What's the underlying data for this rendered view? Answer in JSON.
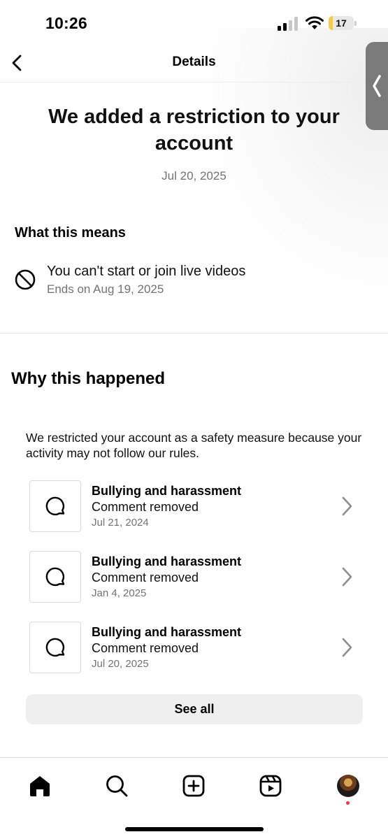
{
  "status_bar": {
    "time": "10:26",
    "battery_level": "17",
    "battery_fraction": 0.17,
    "icons": [
      "cellular-signal-icon",
      "wifi-icon",
      "battery-icon"
    ]
  },
  "nav": {
    "title": "Details",
    "back_icon": "chevron-left-icon"
  },
  "header": {
    "title": "We added a restriction to your account",
    "date": "Jul 20, 2025"
  },
  "meaning": {
    "heading": "What this means",
    "restriction_icon": "prohibited-icon",
    "restriction_title": "You can't start or join live videos",
    "restriction_ends": "Ends on Aug 19, 2025"
  },
  "why": {
    "heading": "Why this happened",
    "body": "We restricted your account as a safety measure because your activity may not follow our rules.",
    "violations": [
      {
        "title": "Bullying and harassment",
        "status": "Comment removed",
        "date": "Jul 21, 2024",
        "icon": "comment-bubble-icon"
      },
      {
        "title": "Bullying and harassment",
        "status": "Comment removed",
        "date": "Jan 4, 2025",
        "icon": "comment-bubble-icon"
      },
      {
        "title": "Bullying and harassment",
        "status": "Comment removed",
        "date": "Jul 20, 2025",
        "icon": "comment-bubble-icon"
      }
    ],
    "see_all_label": "See all"
  },
  "tabbar": {
    "items": [
      "home-icon",
      "search-icon",
      "create-post-icon",
      "reels-icon",
      "profile-avatar"
    ],
    "active": "home-icon"
  },
  "colors": {
    "secondary_text": "#737373",
    "battery_fill": "#f5c94b",
    "button_bg": "#efefef",
    "notification_dot": "#ff3040"
  }
}
